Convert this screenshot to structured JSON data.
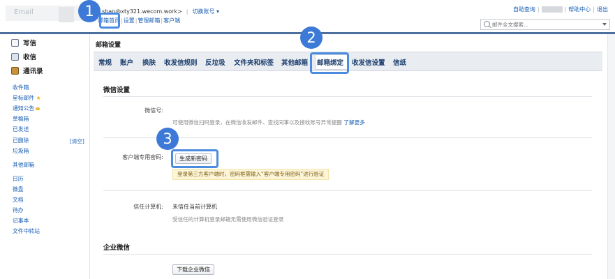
{
  "header": {
    "logo_text": "Email",
    "account_email": "shan@xty321.wecom.work>",
    "switch_account": "切换账号 ▾",
    "top_links": [
      "邮箱首页",
      "设置",
      "管理邮箱",
      "客户端"
    ],
    "right_links": [
      "自助查询",
      "帮助中心",
      "退出"
    ],
    "search_placeholder": "邮件全文搜索..."
  },
  "sidebar": {
    "main_nav": [
      {
        "label": "写信",
        "icon": "compose-icon"
      },
      {
        "label": "收信",
        "icon": "inbox-icon"
      },
      {
        "label": "通讯录",
        "icon": "contacts-icon"
      }
    ],
    "folders": [
      "收件箱",
      "星标邮件",
      "通知公告",
      "草稿箱",
      "已发送",
      "已删除",
      "垃圾箱",
      "其他邮箱",
      "日历",
      "微盘",
      "文档",
      "待办",
      "记事本",
      "文件中转站"
    ],
    "clear_label": "[清空]"
  },
  "main": {
    "title": "邮箱设置",
    "tabs": [
      "常规",
      "账户",
      "换肤",
      "收发信规则",
      "反垃圾",
      "文件夹和标签",
      "其他邮箱",
      "邮箱绑定",
      "收发信设置",
      "信纸"
    ],
    "active_tab": "邮箱绑定",
    "wechat_section": {
      "title": "微信设置",
      "wechat_label": "微信号:",
      "wechat_desc": "可使用微信扫码登录，在微信收发邮件、查找同事以及接收账号异常提醒",
      "learn_more": "了解更多",
      "client_pwd_label": "客户端专用密码:",
      "generate_button": "生成新密码",
      "notice": "登录第三方客户端时，密码框需输入“客户端专用密码”进行验证",
      "trusted_label": "信任计算机:",
      "trusted_value": "未信任当前计算机",
      "trusted_desc": "受信任的计算机登录邮箱无需使用微信验证登录"
    },
    "wework_section": {
      "title": "企业微信",
      "download_button": "下载企业微信"
    }
  },
  "callouts": [
    "1",
    "2",
    "3"
  ],
  "colors": {
    "accent": "#3d79d6",
    "link": "#1a5fb4",
    "header_bar": "#4d6f9f"
  }
}
